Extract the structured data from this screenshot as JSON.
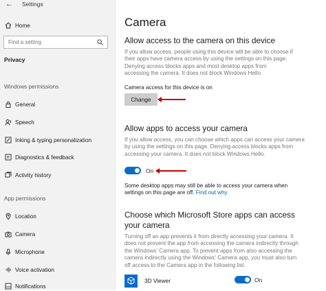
{
  "window": {
    "title": "Settings"
  },
  "sidebar": {
    "home_label": "Home",
    "search_placeholder": "Find a setting",
    "category": "Privacy",
    "windows_permissions_header": "Windows permissions",
    "windows_items": [
      {
        "label": "General",
        "icon": "lock-icon"
      },
      {
        "label": "Speech",
        "icon": "speech-icon"
      },
      {
        "label": "Inking & typing personalization",
        "icon": "inking-icon"
      },
      {
        "label": "Diagnostics & feedback",
        "icon": "diagnostics-icon"
      },
      {
        "label": "Activity history",
        "icon": "activity-icon"
      }
    ],
    "app_permissions_header": "App permissions",
    "app_items": [
      {
        "label": "Location",
        "icon": "location-icon"
      },
      {
        "label": "Camera",
        "icon": "camera-icon"
      },
      {
        "label": "Microphone",
        "icon": "microphone-icon"
      },
      {
        "label": "Voice activation",
        "icon": "voice-icon"
      },
      {
        "label": "Notifications",
        "icon": "notifications-icon"
      }
    ]
  },
  "main": {
    "title": "Camera",
    "device_section": {
      "heading": "Allow access to the camera on this device",
      "lines": [
        "If you allow access, people using this device will be able to choose if",
        "their apps have camera access by using the settings on this page.",
        "Denying access blocks apps and most desktop apps from",
        "accessing the camera. It does not block Windows Hello."
      ],
      "status": "Camera access for this device is on",
      "button_label": "Change"
    },
    "apps_section": {
      "heading": "Allow apps to access your camera",
      "lines": [
        "If you allow access, you can choose which apps can access your camera",
        "by using the settings on this page. Denying access blocks apps from",
        "accessing your camera. It does not block Windows Hello."
      ],
      "toggle_label": "On",
      "toggle_on": true,
      "note_lines": [
        "Some desktop apps may still be able to access your camera when",
        "settings on this page are off."
      ],
      "note_link": "Find out why"
    },
    "store_section": {
      "heading_lines": [
        "Choose which Microsoft Store apps can access",
        "your camera"
      ],
      "lines": [
        "Turning off an app prevents it from directly accessing your camera. It",
        "does not prevent the app from accessing the camera indirectly through",
        "the Windows' Camera app. To prevent apps from also accessing the",
        "camera indirectly using the Windows' Camera app, you must also turn",
        "off access to the Camera app in the following list."
      ],
      "apps": [
        {
          "name": "3D Viewer",
          "toggle_label": "On",
          "toggle_on": true
        }
      ]
    }
  },
  "colors": {
    "accent": "#0b6bcb",
    "annotation_arrow": "#c40000",
    "sidebar_bg": "#f2f2f2"
  }
}
